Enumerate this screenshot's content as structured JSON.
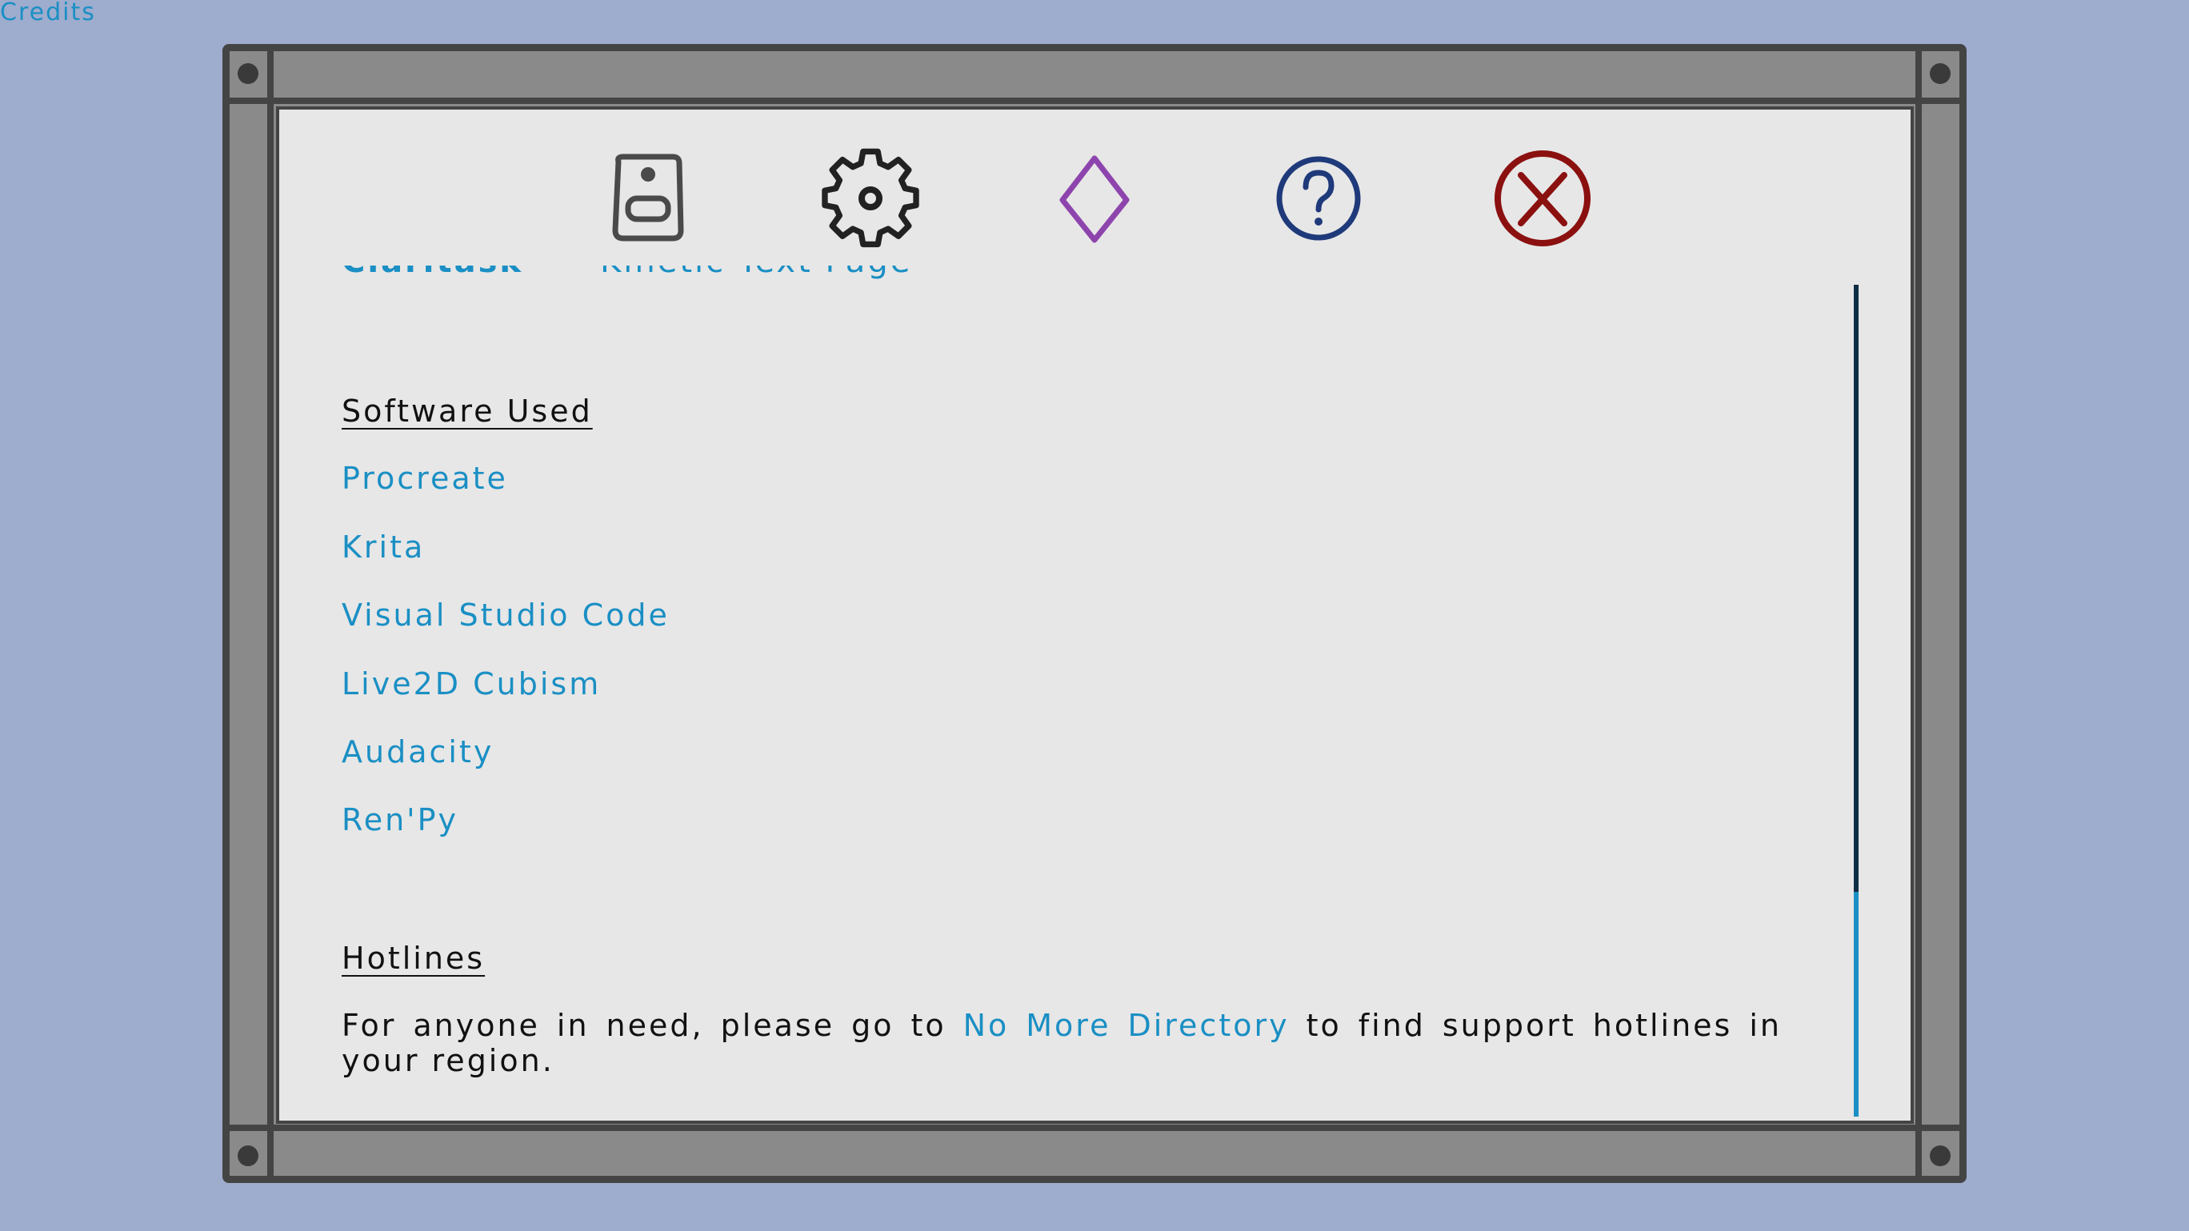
{
  "screen": {
    "title": "Credits"
  },
  "nav": {
    "icons": [
      "save-icon",
      "settings-gear-icon",
      "diamond-icon",
      "help-icon",
      "close-icon"
    ],
    "colors": {
      "save": "#4a4a4a",
      "settings": "#222222",
      "diamond": "#8e44ad",
      "help": "#1f3a7a",
      "close": "#8b1010"
    }
  },
  "content": {
    "cut_off_line": {
      "name": "Claritask",
      "role": "- Kinetic Text Page"
    },
    "software_section": {
      "heading": "Software Used",
      "items": [
        "Procreate",
        "Krita",
        "Visual Studio Code",
        "Live2D Cubism",
        "Audacity",
        "Ren'Py"
      ]
    },
    "hotlines_section": {
      "heading": "Hotlines",
      "text_before": "For anyone in need, please go to",
      "link": "No More Directory",
      "text_after": "to find support hotlines in your region."
    }
  },
  "colors": {
    "background": "#9eaccd",
    "frame": "#8a8a8a",
    "frame_border": "#444444",
    "panel": "#e7e7e7",
    "link": "#1a8fc4",
    "text": "#111111",
    "scroll_thumb": "#0f2e45",
    "scroll_track": "#1a8fc4"
  },
  "scroll": {
    "position_fraction": 0.73
  }
}
